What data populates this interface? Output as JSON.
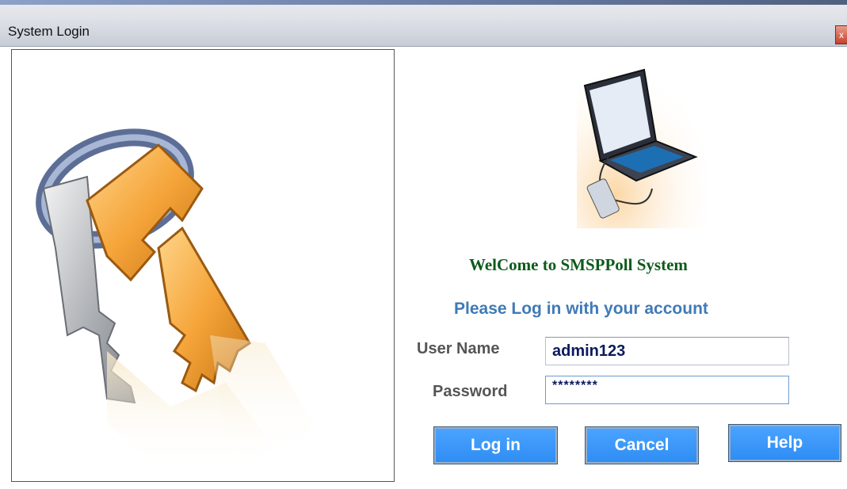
{
  "window": {
    "title": "System Login",
    "close_label": "x"
  },
  "welcome_text": "WelCome to SMSPPoll System",
  "login_prompt": "Please Log in with your account",
  "form": {
    "username_label": "User Name",
    "username_value": "admin123",
    "password_label": "Password",
    "password_value": "********"
  },
  "buttons": {
    "login": "Log in",
    "cancel": "Cancel",
    "help": "Help"
  },
  "colors": {
    "welcome": "#0d5a1b",
    "prompt": "#3f7ab7",
    "button": "#2f8df3",
    "key_gold": "#f2a23a"
  },
  "icons": {
    "left_panel": "keys-icon",
    "header": "laptop-phone-icon"
  }
}
